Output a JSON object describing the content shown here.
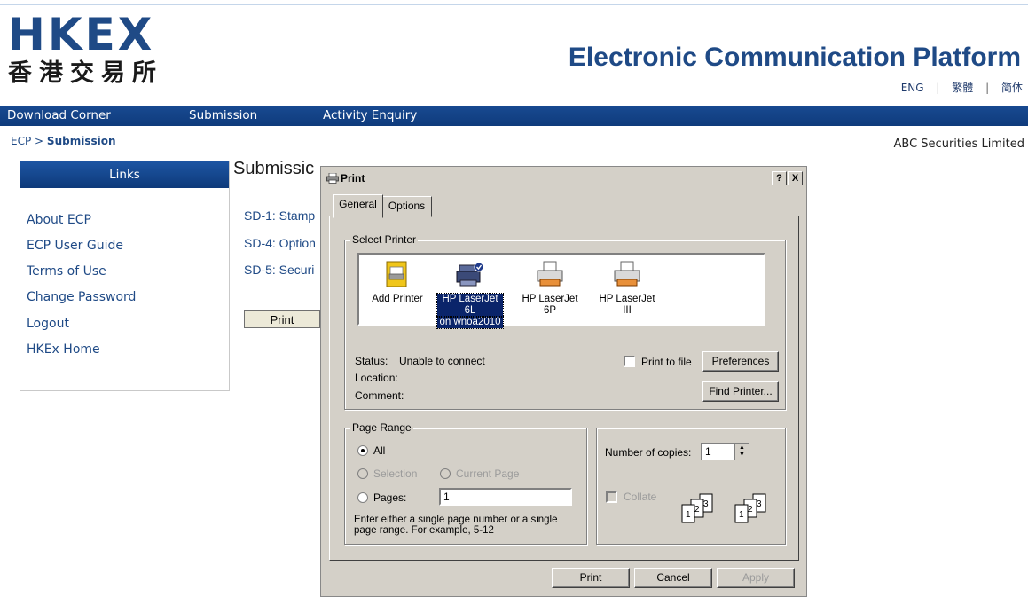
{
  "header": {
    "logo_latin": "HKEX",
    "logo_cjk": "香港交易所",
    "title": "Electronic Communication Platform",
    "languages": [
      "ENG",
      "繁體",
      "简体"
    ],
    "separator": "|"
  },
  "nav": {
    "items": [
      "Download Corner",
      "Submission",
      "Activity Enquiry"
    ]
  },
  "breadcrumb": {
    "root": "ECP",
    "sep": ">",
    "current": "Submission"
  },
  "company": "ABC Securities Limited",
  "links": {
    "heading": "Links",
    "items": [
      "About ECP",
      "ECP User Guide",
      "Terms of Use",
      "Change Password",
      "Logout",
      "HKEx Home"
    ]
  },
  "submission": {
    "title": "Submissic",
    "items": [
      "SD-1: Stamp",
      "SD-4: Option",
      "SD-5: Securi"
    ],
    "print_label": "Print"
  },
  "dialog": {
    "title": "Print",
    "help": "?",
    "close": "X",
    "tabs": [
      "General",
      "Options"
    ],
    "select_printer": {
      "label": "Select Printer",
      "printers": [
        {
          "line1": "Add Printer",
          "line2": "",
          "selected": false
        },
        {
          "line1": "HP LaserJet 6L",
          "line2": "on wnoa2010",
          "selected": true
        },
        {
          "line1": "HP LaserJet",
          "line2": "6P",
          "selected": false
        },
        {
          "line1": "HP LaserJet",
          "line2": "III",
          "selected": false
        }
      ],
      "status_label": "Status:",
      "status_value": "Unable to connect",
      "location_label": "Location:",
      "comment_label": "Comment:",
      "print_to_file": "Print to file",
      "preferences": "Preferences",
      "find_printer": "Find Printer..."
    },
    "page_range": {
      "label": "Page Range",
      "all": "All",
      "selection": "Selection",
      "current_page": "Current Page",
      "pages": "Pages:",
      "pages_value": "1",
      "hint": "Enter either a single page number or a single page range.  For example, 5-12"
    },
    "copies": {
      "label": "Number of copies:",
      "value": "1",
      "collate": "Collate"
    },
    "buttons": {
      "print": "Print",
      "cancel": "Cancel",
      "apply": "Apply"
    }
  },
  "colors": {
    "brand_blue": "#1f4a86",
    "nav_blue": "#184a91",
    "dialog_bg": "#d4d0c8",
    "selection": "#0a246a"
  }
}
